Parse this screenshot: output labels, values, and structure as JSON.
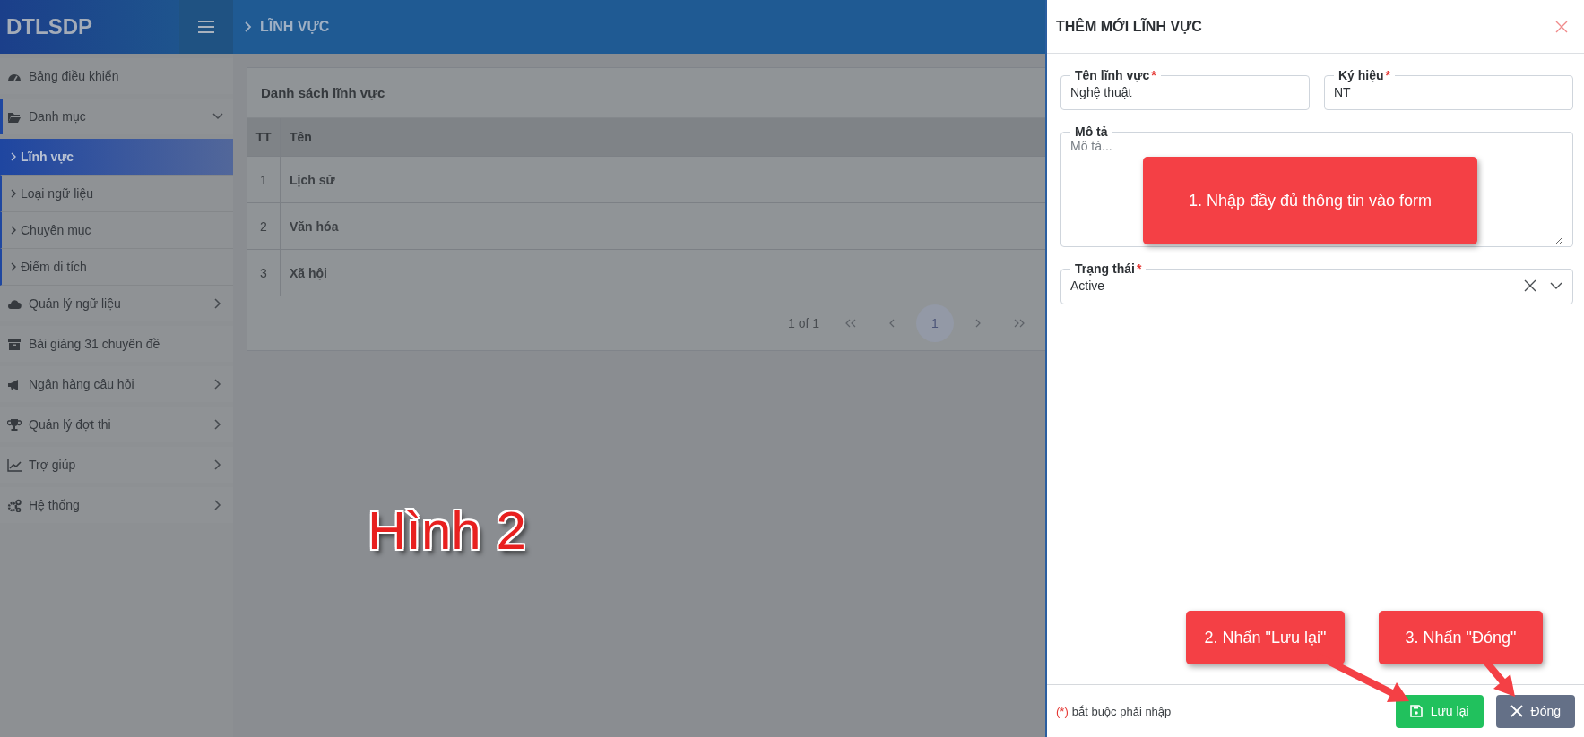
{
  "app": {
    "logo": "DTLSDP",
    "breadcrumb": "LĨNH VỰC"
  },
  "sidebar": {
    "items": [
      {
        "label": "Bảng điều khiển",
        "kind": "link"
      },
      {
        "label": "Danh mục",
        "kind": "group",
        "expanded": true,
        "children": [
          {
            "label": "Lĩnh vực",
            "selected": true
          },
          {
            "label": "Loại ngữ liệu",
            "selected": false
          },
          {
            "label": "Chuyên mục",
            "selected": false
          },
          {
            "label": "Điểm di tích",
            "selected": false
          }
        ]
      },
      {
        "label": "Quản lý ngữ liệu",
        "kind": "group",
        "expanded": false
      },
      {
        "label": "Bài giảng 31 chuyên đề",
        "kind": "link"
      },
      {
        "label": "Ngân hàng câu hỏi",
        "kind": "group",
        "expanded": false
      },
      {
        "label": "Quản lý đợt thi",
        "kind": "group",
        "expanded": false
      },
      {
        "label": "Trợ giúp",
        "kind": "group",
        "expanded": false
      },
      {
        "label": "Hệ thống",
        "kind": "group",
        "expanded": false
      }
    ]
  },
  "card": {
    "title": "Danh sách lĩnh vực",
    "table": {
      "columns": [
        "TT",
        "Tên"
      ],
      "rows": [
        [
          "1",
          "Lịch sử"
        ],
        [
          "2",
          "Văn hóa"
        ],
        [
          "3",
          "Xã hội"
        ]
      ]
    },
    "pagination": {
      "summary": "1 of 1",
      "pages": [
        {
          "label": "1",
          "selected": true
        }
      ]
    }
  },
  "drawer": {
    "title": "THÊM MỚI LĨNH VỰC",
    "fields": [
      {
        "kind": "input",
        "label": "Tên lĩnh vực",
        "mark": "*",
        "value": "Nghệ thuật"
      },
      {
        "kind": "input",
        "label": "Ký hiệu",
        "mark": "*",
        "value": "NT"
      },
      {
        "kind": "textarea",
        "label": "Mô tả",
        "placeholder": "Mô tả..."
      },
      {
        "kind": "select",
        "label": "Trạng thái",
        "mark": "*",
        "value": "Active"
      }
    ],
    "footer": {
      "note_mark": "(*)",
      "note": "bắt buộc phải nhập"
    },
    "buttons": [
      {
        "kind": "save",
        "label": "Lưu lại"
      },
      {
        "kind": "close",
        "label": "Đóng"
      }
    ]
  },
  "annotations": {
    "heading": "Hình 2",
    "callouts": [
      {
        "text": "1. Nhập đầy đủ thông tin vào form"
      },
      {
        "text": "2. Nhấn \"Lưu lại\""
      },
      {
        "text": "3. Nhấn \"Đóng\""
      }
    ]
  }
}
